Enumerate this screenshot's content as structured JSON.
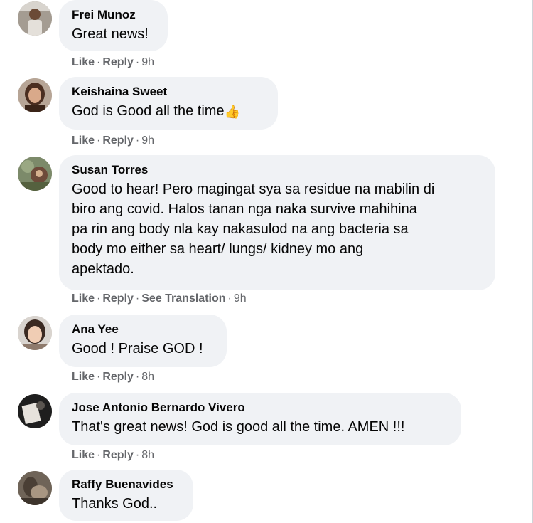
{
  "comments": [
    {
      "author": "Frei Munoz",
      "text": "Great news!",
      "actions": {
        "like": "Like",
        "reply": "Reply",
        "time": "9h"
      }
    },
    {
      "author": "Keishaina Sweet",
      "text": "God is Good all the time",
      "emoji": "👍",
      "actions": {
        "like": "Like",
        "reply": "Reply",
        "time": "9h"
      }
    },
    {
      "author": "Susan Torres",
      "text": "Good to hear! Pero magingat sya sa residue na mabilin di\nbiro ang covid. Halos tanan nga naka survive mahihina\npa rin ang body nla kay nakasulod na ang bacteria sa\nbody mo either sa heart/ lungs/ kidney mo ang\napektado.",
      "actions": {
        "like": "Like",
        "reply": "Reply",
        "translate": "See Translation",
        "time": "9h"
      }
    },
    {
      "author": "Ana Yee",
      "text": "Good ! Praise GOD !",
      "actions": {
        "like": "Like",
        "reply": "Reply",
        "time": "8h"
      }
    },
    {
      "author": "Jose Antonio Bernardo Vivero",
      "text": "That's great news! God is good all the time. AMEN !!!",
      "actions": {
        "like": "Like",
        "reply": "Reply",
        "time": "8h"
      }
    },
    {
      "author": "Raffy Buenavides",
      "text": "Thanks God..",
      "actions": {}
    }
  ],
  "separator": "·",
  "colors": {
    "bubble_bg": "#f0f2f5",
    "text": "#050505",
    "meta": "#65676b"
  },
  "icons": {
    "thumbs_up": "thumbs-up-emoji"
  }
}
